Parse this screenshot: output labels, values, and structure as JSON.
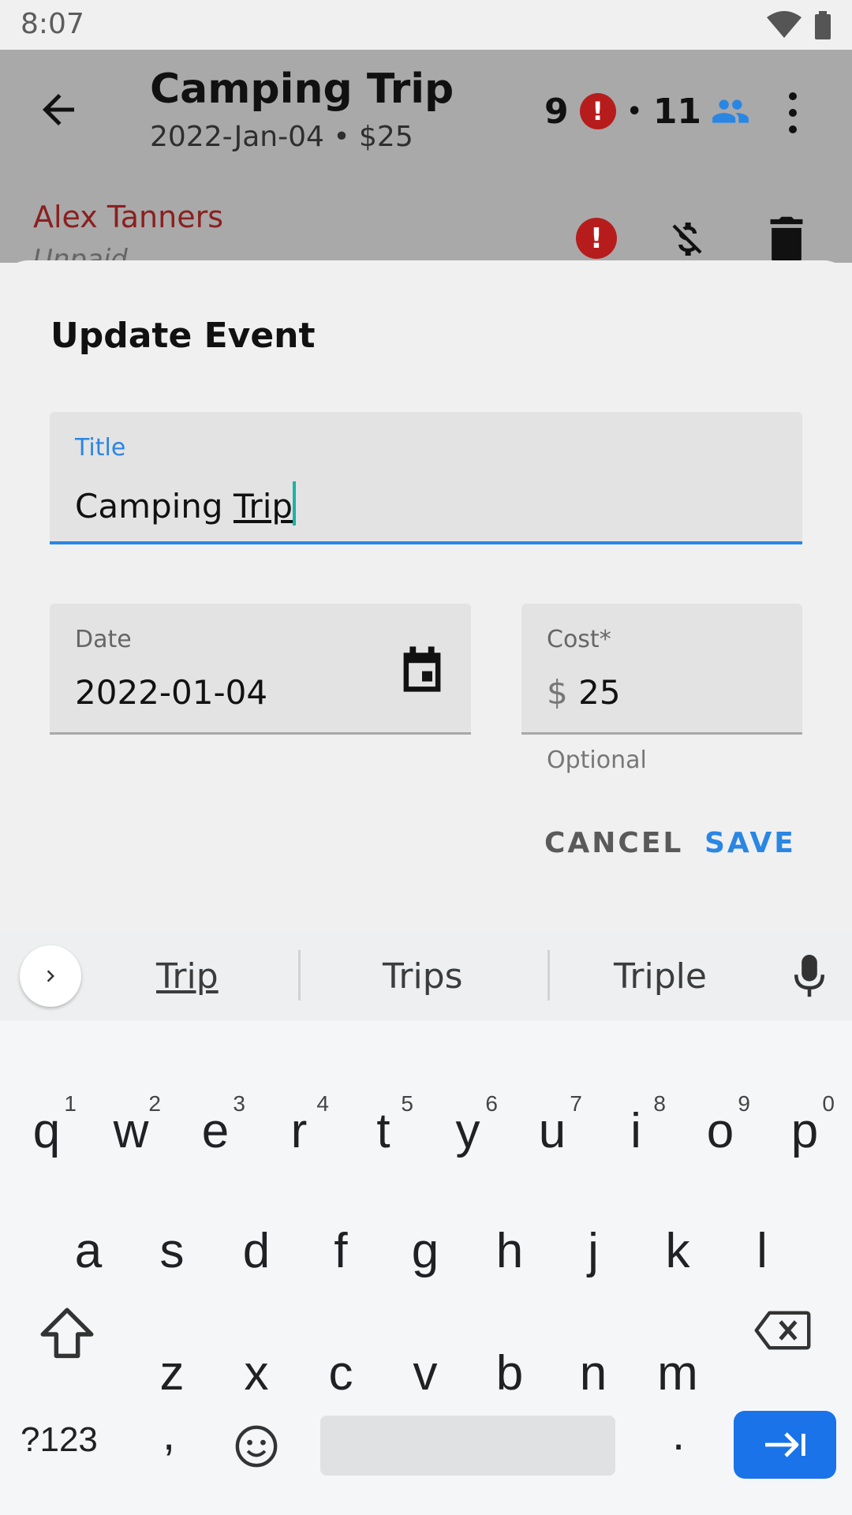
{
  "status_bar": {
    "time": "8:07"
  },
  "app_bar": {
    "title": "Camping Trip",
    "subtitle": "2022-Jan-04  •  $25",
    "unpaid_count": "9",
    "stat_separator": "•",
    "member_count": "11"
  },
  "member_row": {
    "name": "Alex Tanners",
    "status": "Unpaid"
  },
  "dialog": {
    "title": "Update Event",
    "title_field": {
      "label": "Title",
      "value_plain": "Camping ",
      "value_underlined": "Trip"
    },
    "date_field": {
      "label": "Date",
      "value": "2022-01-04"
    },
    "cost_field": {
      "label": "Cost*",
      "prefix": "$",
      "value": "25",
      "helper": "Optional"
    },
    "cancel_label": "CANCEL",
    "save_label": "SAVE"
  },
  "keyboard": {
    "suggestions": [
      "Trip",
      "Trips",
      "Triple"
    ],
    "row1": [
      {
        "key": "q",
        "hint": "1"
      },
      {
        "key": "w",
        "hint": "2"
      },
      {
        "key": "e",
        "hint": "3"
      },
      {
        "key": "r",
        "hint": "4"
      },
      {
        "key": "t",
        "hint": "5"
      },
      {
        "key": "y",
        "hint": "6"
      },
      {
        "key": "u",
        "hint": "7"
      },
      {
        "key": "i",
        "hint": "8"
      },
      {
        "key": "o",
        "hint": "9"
      },
      {
        "key": "p",
        "hint": "0"
      }
    ],
    "row2": [
      "a",
      "s",
      "d",
      "f",
      "g",
      "h",
      "j",
      "k",
      "l"
    ],
    "row3": [
      "z",
      "x",
      "c",
      "v",
      "b",
      "n",
      "m"
    ],
    "symbols_label": "?123",
    "comma": ",",
    "period": "."
  },
  "icons": {
    "back": "arrow-left-icon",
    "alert": "alert-circle-icon",
    "people": "people-icon",
    "more": "more-vert-icon",
    "money_off": "money-off-icon",
    "delete": "trash-icon",
    "calendar": "calendar-icon",
    "expand": "chevron-right-icon",
    "mic": "mic-icon",
    "shift": "shift-icon",
    "backspace": "backspace-icon",
    "emoji": "emoji-icon",
    "next": "tab-next-icon"
  },
  "colors": {
    "accent": "#2a86e3",
    "alert": "#b71c1c",
    "member_name": "#8a2020",
    "enter_key": "#1a73e8",
    "caret": "#18b4a4"
  }
}
